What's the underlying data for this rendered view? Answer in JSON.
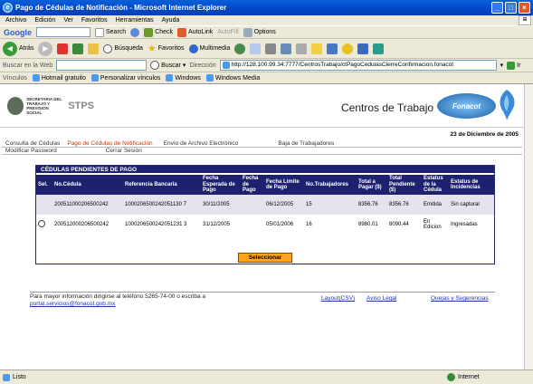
{
  "window": {
    "title": "Pago de Cédulas de Notificación - Microsoft Internet Explorer"
  },
  "menu": [
    "Archivo",
    "Edición",
    "Ver",
    "Favoritos",
    "Herramientas",
    "Ayuda"
  ],
  "google_toolbar": {
    "logo": "Google",
    "search_label": "Search",
    "check_label": "Check",
    "autolink_label": "AutoLink",
    "autofill_label": "AutoFill",
    "options_label": "Options"
  },
  "nav_toolbar": {
    "back_label": "Atrás",
    "search_label": "Búsqueda",
    "favorites_label": "Favoritos",
    "multimedia_label": "Multimedia"
  },
  "address_row": {
    "web_search_label": "Buscar en la Web",
    "search_button_label": "Buscar",
    "address_label": "Dirección",
    "url": "http://128.100.99.34:7777/CentrosTrabajo/ctPagoCedulasCierreConfirmacion.fonacot",
    "go_label": "Ir"
  },
  "links_row": {
    "label": "Vínculos",
    "items": [
      "Hotmail gratuito",
      "Personalizar vínculos",
      "Windows",
      "Windows Media"
    ]
  },
  "header": {
    "agency_text": [
      "SECRETARIA DEL",
      "TRABAJO Y",
      "PREVISION SOCIAL"
    ],
    "agency_acronym": "STPS",
    "site_title": "Centros de Trabajo",
    "brand": "Fonacot",
    "date": "23 de Diciembre de 2005"
  },
  "tabs": {
    "row1": [
      "Consulta de Cédulas",
      "Pago de Cédulas de Notificación",
      "Envío de Archivo Electrónico",
      "Baja de Trabajadores"
    ],
    "row2": [
      "Modificar Password",
      "Cerrar Sesión"
    ],
    "active": "Pago de Cédulas de Notificación"
  },
  "panel": {
    "title": "CÉDULAS PENDIENTES DE PAGO",
    "columns": [
      "Sel.",
      "No.Cédula",
      "Referencia Bancaria",
      "Fecha Esperada de Pago",
      "Fecha de Pago",
      "Fecha Límite de Pago",
      "No.Trabajadores",
      "Total a Pagar ($)",
      "Total Pendiente ($)",
      "Estatus de la Cédula",
      "Estatus de Incidencias"
    ],
    "rows": [
      {
        "sel": false,
        "no_cedula": "200511000206500242",
        "referencia": "1000206500242051130 7",
        "fecha_esperada": "30/11/2005",
        "fecha_pago": "",
        "fecha_limite": "06/12/2005",
        "trabajadores": "15",
        "total_pagar": "8356.76",
        "total_pendiente": "8356.76",
        "estatus": "Emitida",
        "incidencias": "Sin capturar"
      },
      {
        "sel": true,
        "no_cedula": "200512000206500242",
        "referencia": "1000206500242051231 3",
        "fecha_esperada": "31/12/2005",
        "fecha_pago": "",
        "fecha_limite": "05/01/2006",
        "trabajadores": "16",
        "total_pagar": "8980.01",
        "total_pendiente": "8090.44",
        "estatus": "En Edicion",
        "incidencias": "Ingresadas"
      }
    ],
    "select_button": "Seleccionar"
  },
  "footer": {
    "info_line1": "Para mayor información dirigirse al teléfono 5265-74-00 o escriba a",
    "email": "portal.servicios@fonacot.gob.mx",
    "link_layout": "Layout(CSV)",
    "link_aviso": "Aviso Legal",
    "link_quejas": "Quejas y Sugerencias"
  },
  "status": {
    "left": "Listo",
    "zone": "Internet"
  }
}
